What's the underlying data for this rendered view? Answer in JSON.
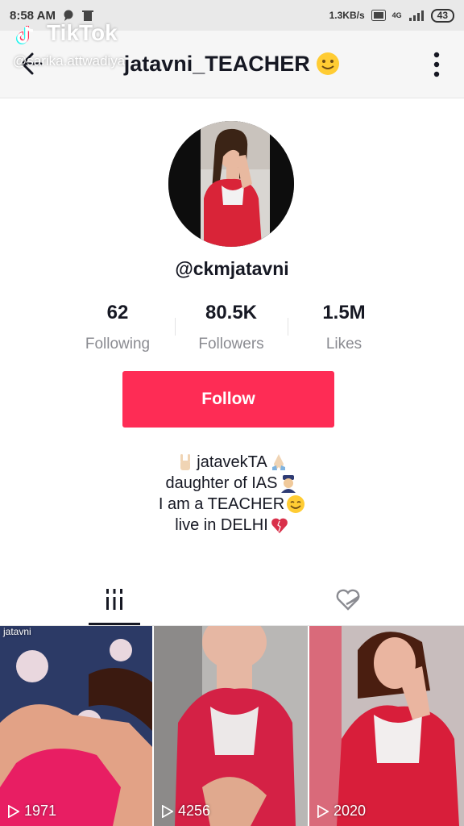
{
  "status_bar": {
    "time": "8:58 AM",
    "net_speed": "1.3KB/s",
    "network": "4G",
    "battery": "43"
  },
  "watermark": {
    "brand": "TikTok",
    "user": "@sarika.attwadiya"
  },
  "header": {
    "title": "jatavni_TEACHER",
    "title_emoji": "slightly-smiling-face"
  },
  "profile": {
    "username": "@ckmjatavni",
    "stats": [
      {
        "value": "62",
        "label": "Following"
      },
      {
        "value": "80.5K",
        "label": "Followers"
      },
      {
        "value": "1.5M",
        "label": "Likes"
      }
    ],
    "follow_label": "Follow",
    "bio": [
      {
        "text": "jatavekTA",
        "emoji_before": "sign-of-the-horns",
        "emoji_after": "folded-hands"
      },
      {
        "text": "daughter of IAS",
        "emoji_after": "police-officer"
      },
      {
        "text": "I am a TEACHER",
        "emoji_after": "smiling-face"
      },
      {
        "text": "live in DELHI",
        "emoji_after": "mending-heart"
      }
    ]
  },
  "tabs": [
    {
      "name": "videos",
      "icon": "grid-bars-icon",
      "active": true
    },
    {
      "name": "liked",
      "icon": "liked-heart-icon",
      "active": false
    }
  ],
  "videos": [
    {
      "play_count": "1971",
      "caption": "jatavni"
    },
    {
      "play_count": "4256"
    },
    {
      "play_count": "2020"
    }
  ],
  "colors": {
    "accent": "#fe2c55",
    "text_primary": "#161823",
    "text_secondary": "#8a8b91"
  }
}
